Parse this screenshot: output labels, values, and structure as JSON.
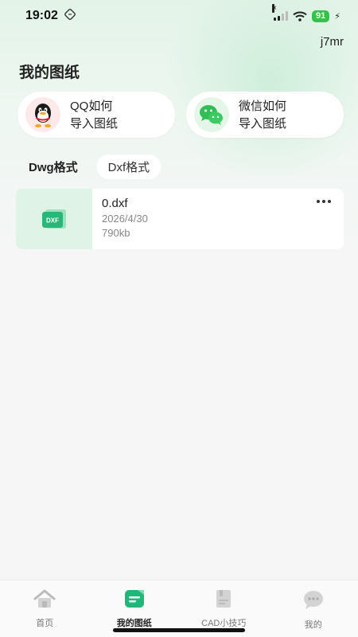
{
  "status_bar": {
    "time": "19:02",
    "signal_mark": "×",
    "battery": "91",
    "charging_icon": "⚡"
  },
  "header": {
    "user": "j7mr",
    "title": "我的图纸"
  },
  "import_cards": [
    {
      "icon": "qq-icon",
      "line1": "QQ如何",
      "line2": "导入图纸"
    },
    {
      "icon": "wechat-icon",
      "line1": "微信如何",
      "line2": "导入图纸"
    }
  ],
  "tabs": [
    {
      "label": "Dwg格式",
      "active": true
    },
    {
      "label": "Dxf格式",
      "active": false
    }
  ],
  "files": [
    {
      "thumb_label": "DXF",
      "name": "0.dxf",
      "date": "2026/4/30",
      "size": "790kb"
    }
  ],
  "bottom_nav": [
    {
      "label": "首页",
      "icon": "home-icon"
    },
    {
      "label": "我的图纸",
      "icon": "drawings-icon",
      "active": true
    },
    {
      "label": "CAD小技巧",
      "icon": "tips-icon"
    },
    {
      "label": "我的",
      "icon": "profile-icon"
    }
  ],
  "colors": {
    "accent": "#1fb87a",
    "battery": "#35c24a",
    "background": "#f6f6f6"
  }
}
